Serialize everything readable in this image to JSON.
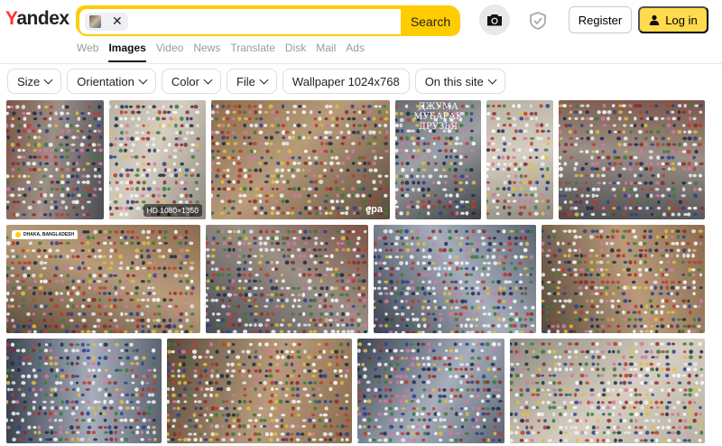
{
  "logo": {
    "text_y": "Y",
    "text_rest": "andex"
  },
  "search": {
    "button_label": "Search",
    "clear_icon": "close-icon"
  },
  "header": {
    "register_label": "Register",
    "login_label": "Log in"
  },
  "tabs": [
    {
      "label": "Web",
      "active": false
    },
    {
      "label": "Images",
      "active": true
    },
    {
      "label": "Video",
      "active": false
    },
    {
      "label": "News",
      "active": false
    },
    {
      "label": "Translate",
      "active": false
    },
    {
      "label": "Disk",
      "active": false
    },
    {
      "label": "Mail",
      "active": false
    },
    {
      "label": "Ads",
      "active": false
    }
  ],
  "filters": [
    {
      "label": "Size",
      "has_chevron": true
    },
    {
      "label": "Orientation",
      "has_chevron": true
    },
    {
      "label": "Color",
      "has_chevron": true
    },
    {
      "label": "File",
      "has_chevron": true
    },
    {
      "label": "Wallpaper 1024x768",
      "has_chevron": false
    },
    {
      "label": "On this site",
      "has_chevron": true
    }
  ],
  "results": {
    "badge_hd": "HD 1080×1350",
    "badge_epa": "epa",
    "overlay_line1": "ДЖУМА МУБАРАК",
    "overlay_line2": "ДРУЗЬЯ",
    "location_tag": "DHAKA, BANGLADESH"
  },
  "colors": {
    "accent": "#ffcc00",
    "login_bg": "#ffdb4d",
    "logo_red": "#ff3333"
  }
}
